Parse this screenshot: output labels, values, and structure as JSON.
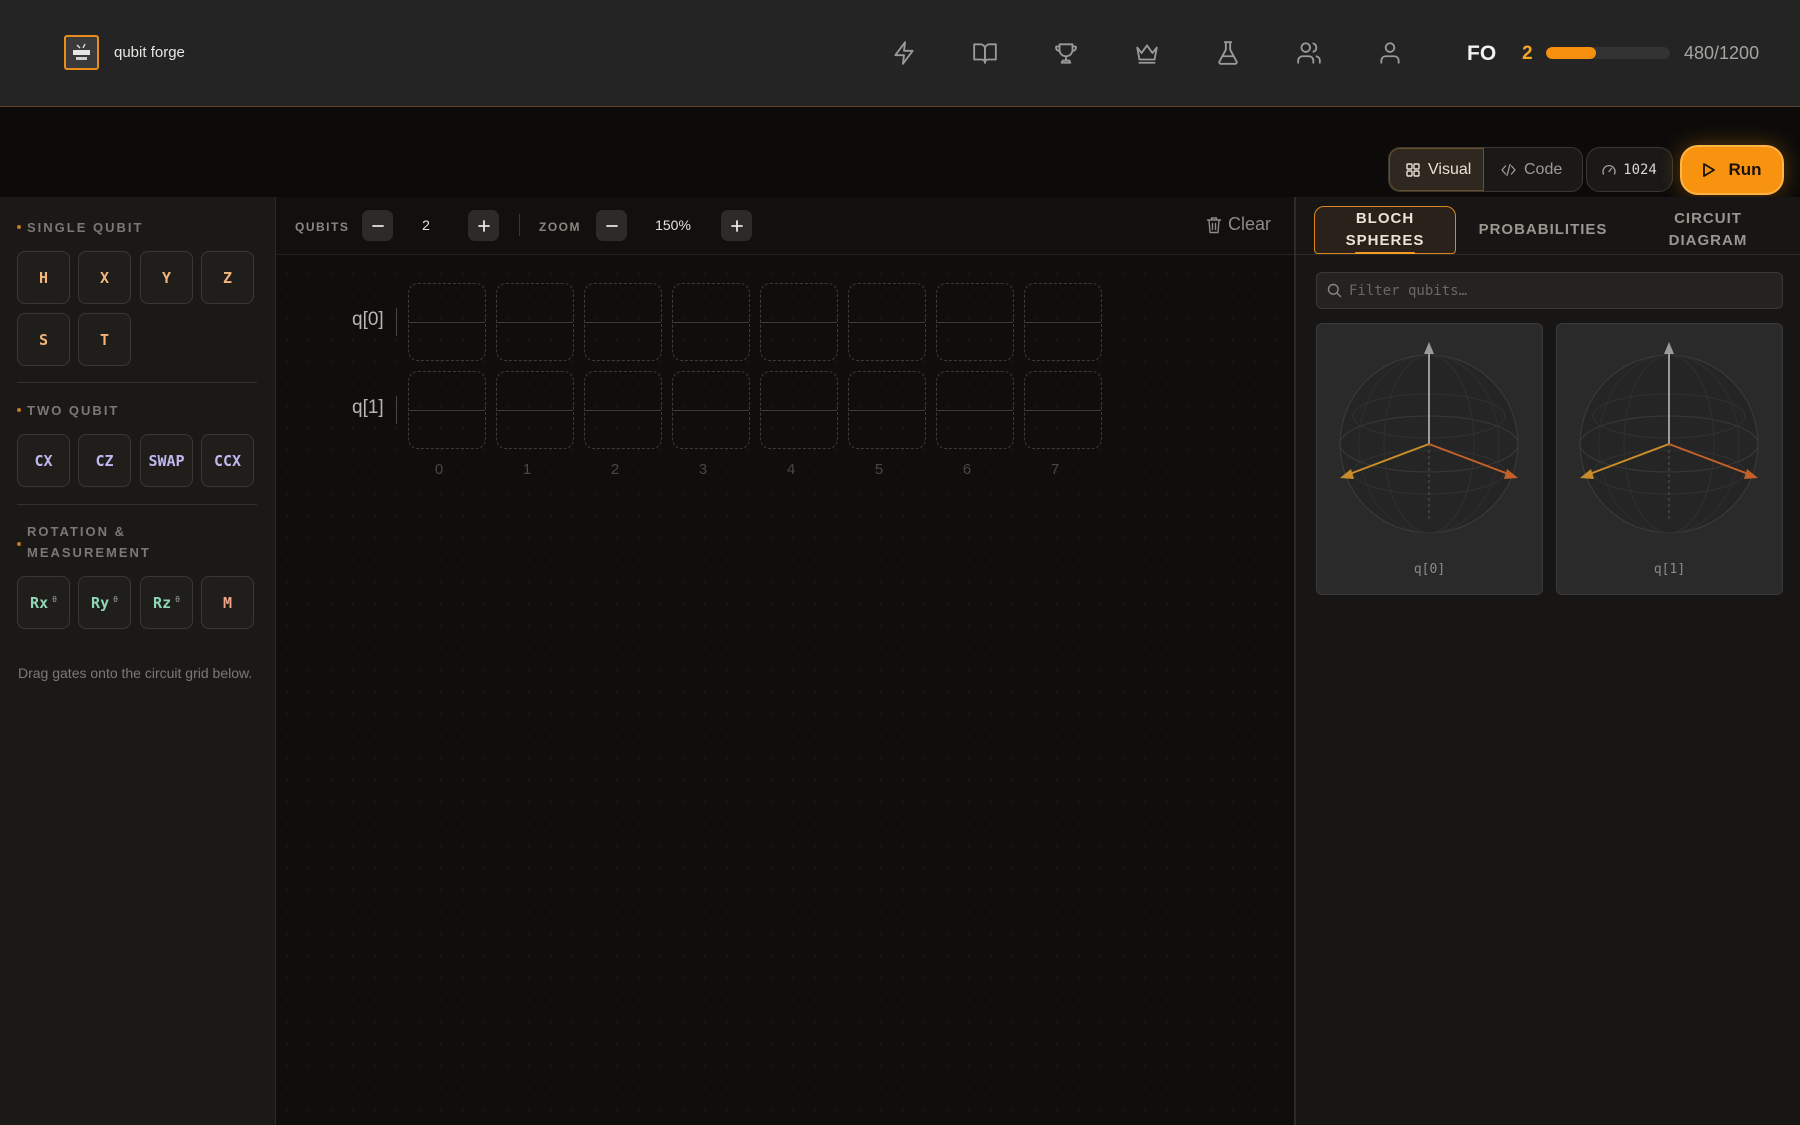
{
  "app": {
    "name": "qubit forge"
  },
  "nav": {
    "items": [
      {
        "name": "lightning-icon"
      },
      {
        "name": "book-icon"
      },
      {
        "name": "trophy-icon"
      },
      {
        "name": "crown-icon"
      },
      {
        "name": "flask-icon"
      },
      {
        "name": "users-icon"
      },
      {
        "name": "user-icon"
      }
    ]
  },
  "user": {
    "initials": "FO",
    "level": "2",
    "xp_text": "480/1200",
    "xp_current": 480,
    "xp_max": 1200
  },
  "toolbar": {
    "visual_label": "Visual",
    "code_label": "Code",
    "shots": "1024",
    "run_label": "Run"
  },
  "palette": {
    "single_title": "SINGLE QUBIT",
    "single_gates": [
      "H",
      "X",
      "Y",
      "Z",
      "S",
      "T"
    ],
    "two_title": "TWO QUBIT",
    "two_gates": [
      "CX",
      "CZ",
      "SWAP",
      "CCX"
    ],
    "rot_title_line1": "ROTATION &",
    "rot_title_line2": "MEASUREMENT",
    "rot_gates": [
      {
        "label": "Rx",
        "param": "θ"
      },
      {
        "label": "Ry",
        "param": "θ"
      },
      {
        "label": "Rz",
        "param": "θ"
      },
      {
        "label": "M",
        "param": ""
      }
    ],
    "hint": "Drag gates onto the circuit grid below."
  },
  "circuit": {
    "qubits_label": "QUBITS",
    "qubits": "2",
    "zoom_label": "ZOOM",
    "zoom": "150%",
    "clear_label": "Clear",
    "rows": [
      "q[0]",
      "q[1]"
    ],
    "columns": [
      "0",
      "1",
      "2",
      "3",
      "4",
      "5",
      "6",
      "7"
    ]
  },
  "panel": {
    "tabs": [
      {
        "line1": "BLOCH",
        "line2": "SPHERES",
        "active": true
      },
      {
        "line1": "PROBABILITIES",
        "line2": "",
        "active": false
      },
      {
        "line1": "CIRCUIT",
        "line2": "DIAGRAM",
        "active": false
      }
    ],
    "filter_placeholder": "Filter qubits…",
    "spheres": [
      "q[0]",
      "q[1]"
    ]
  },
  "colors": {
    "accent": "#f7930f",
    "background": "#0c0b0a",
    "header": "#242424",
    "single_gate": "#f3b57a",
    "two_gate": "#c0b7ee",
    "rotation_gate": "#8ed6b5",
    "measure_gate": "#f0a58a"
  }
}
